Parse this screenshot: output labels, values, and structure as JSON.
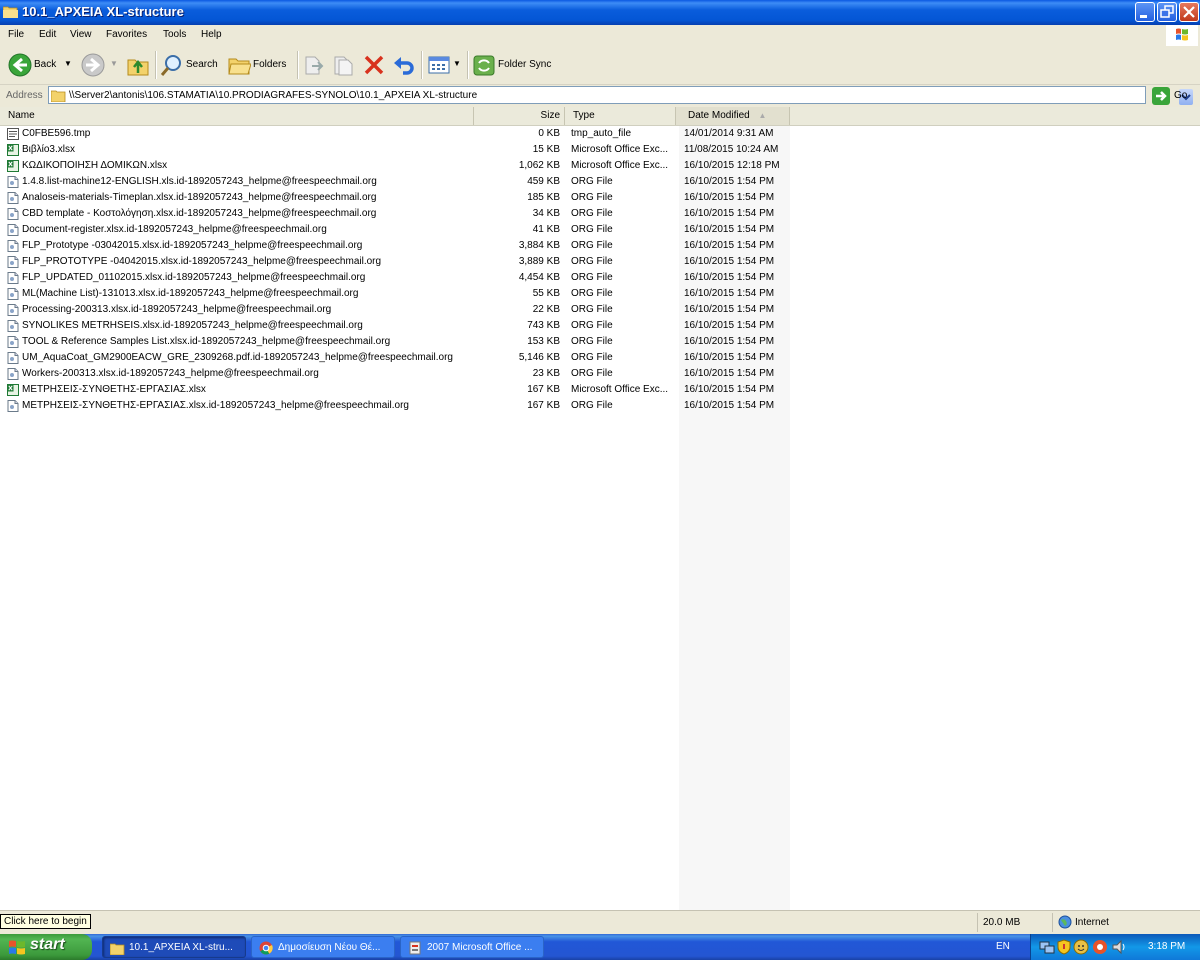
{
  "window": {
    "title": "10.1_ΑΡΧΕΙΑ XL-structure"
  },
  "menu": [
    "File",
    "Edit",
    "View",
    "Favorites",
    "Tools",
    "Help"
  ],
  "toolbar": {
    "back_label": "Back",
    "search_label": "Search",
    "folders_label": "Folders",
    "folder_sync_label": "Folder Sync"
  },
  "address": {
    "label": "Address",
    "path": "\\\\Server2\\antonis\\106.STAMATIA\\10.PRODIAGRAFES-SYNOLO\\10.1_ΑΡΧΕΙΑ XL-structure",
    "go_label": "Go"
  },
  "columns": {
    "name": "Name",
    "size": "Size",
    "type": "Type",
    "date": "Date Modified"
  },
  "files": [
    {
      "name": "C0FBE596.tmp",
      "size": "0 KB",
      "type": "tmp_auto_file",
      "date": "14/01/2014 9:31 AM",
      "icon": "tmp-file-icon"
    },
    {
      "name": "Βιβλίο3.xlsx",
      "size": "15 KB",
      "type": "Microsoft Office Exc...",
      "date": "11/08/2015 10:24 AM",
      "icon": "excel-file-icon"
    },
    {
      "name": "ΚΩΔΙΚΟΠΟΙΗΣΗ ΔΟΜΙΚΩΝ.xlsx",
      "size": "1,062 KB",
      "type": "Microsoft Office Exc...",
      "date": "16/10/2015 12:18 PM",
      "icon": "excel-file-icon"
    },
    {
      "name": "1.4.8.list-machine12-ENGLISH.xls.id-1892057243_helpme@freespeechmail.org",
      "size": "459 KB",
      "type": "ORG File",
      "date": "16/10/2015 1:54 PM",
      "icon": "generic-file-icon"
    },
    {
      "name": "Analoseis-materials-Timeplan.xlsx.id-1892057243_helpme@freespeechmail.org",
      "size": "185 KB",
      "type": "ORG File",
      "date": "16/10/2015 1:54 PM",
      "icon": "generic-file-icon"
    },
    {
      "name": "CBD template - Κοστολόγηση.xlsx.id-1892057243_helpme@freespeechmail.org",
      "size": "34 KB",
      "type": "ORG File",
      "date": "16/10/2015 1:54 PM",
      "icon": "generic-file-icon"
    },
    {
      "name": "Document-register.xlsx.id-1892057243_helpme@freespeechmail.org",
      "size": "41 KB",
      "type": "ORG File",
      "date": "16/10/2015 1:54 PM",
      "icon": "generic-file-icon"
    },
    {
      "name": "FLP_Prototype -03042015.xlsx.id-1892057243_helpme@freespeechmail.org",
      "size": "3,884 KB",
      "type": "ORG File",
      "date": "16/10/2015 1:54 PM",
      "icon": "generic-file-icon"
    },
    {
      "name": "FLP_PROTOTYPE -04042015.xlsx.id-1892057243_helpme@freespeechmail.org",
      "size": "3,889 KB",
      "type": "ORG File",
      "date": "16/10/2015 1:54 PM",
      "icon": "generic-file-icon"
    },
    {
      "name": "FLP_UPDATED_01102015.xlsx.id-1892057243_helpme@freespeechmail.org",
      "size": "4,454 KB",
      "type": "ORG File",
      "date": "16/10/2015 1:54 PM",
      "icon": "generic-file-icon"
    },
    {
      "name": "ML(Machine List)-131013.xlsx.id-1892057243_helpme@freespeechmail.org",
      "size": "55 KB",
      "type": "ORG File",
      "date": "16/10/2015 1:54 PM",
      "icon": "generic-file-icon"
    },
    {
      "name": "Processing-200313.xlsx.id-1892057243_helpme@freespeechmail.org",
      "size": "22 KB",
      "type": "ORG File",
      "date": "16/10/2015 1:54 PM",
      "icon": "generic-file-icon"
    },
    {
      "name": "SYNOLIKES METRHSEIS.xlsx.id-1892057243_helpme@freespeechmail.org",
      "size": "743 KB",
      "type": "ORG File",
      "date": "16/10/2015 1:54 PM",
      "icon": "generic-file-icon"
    },
    {
      "name": "TOOL & Reference Samples List.xlsx.id-1892057243_helpme@freespeechmail.org",
      "size": "153 KB",
      "type": "ORG File",
      "date": "16/10/2015 1:54 PM",
      "icon": "generic-file-icon"
    },
    {
      "name": "UM_AquaCoat_GM2900EACW_GRE_2309268.pdf.id-1892057243_helpme@freespeechmail.org",
      "size": "5,146 KB",
      "type": "ORG File",
      "date": "16/10/2015 1:54 PM",
      "icon": "generic-file-icon"
    },
    {
      "name": "Workers-200313.xlsx.id-1892057243_helpme@freespeechmail.org",
      "size": "23 KB",
      "type": "ORG File",
      "date": "16/10/2015 1:54 PM",
      "icon": "generic-file-icon"
    },
    {
      "name": "ΜΕΤΡΗΣΕΙΣ-ΣΥΝΘΕΤΗΣ-ΕΡΓΑΣΙΑΣ.xlsx",
      "size": "167 KB",
      "type": "Microsoft Office Exc...",
      "date": "16/10/2015 1:54 PM",
      "icon": "excel-file-icon"
    },
    {
      "name": "ΜΕΤΡΗΣΕΙΣ-ΣΥΝΘΕΤΗΣ-ΕΡΓΑΣΙΑΣ.xlsx.id-1892057243_helpme@freespeechmail.org",
      "size": "167 KB",
      "type": "ORG File",
      "date": "16/10/2015 1:54 PM",
      "icon": "generic-file-icon"
    }
  ],
  "status": {
    "tooltip": "Click here to begin",
    "size": "20.0 MB",
    "zone": "Internet"
  },
  "taskbar": {
    "start_label": "start",
    "tasks": [
      {
        "label": "10.1_ΑΡΧΕΙΑ XL-stru...",
        "active": true,
        "icon": "folder-icon"
      },
      {
        "label": "Δημοσίευση Νέου Θέ...",
        "active": false,
        "icon": "chrome-icon"
      },
      {
        "label": "2007 Microsoft Office ...",
        "active": false,
        "icon": "office-icon"
      }
    ],
    "language": "EN",
    "clock": "3:18 PM"
  },
  "colors": {
    "title_bar": "#0a5ddc",
    "taskbar": "#2456d2",
    "start_button": "#3c9a3c",
    "chrome": "#ece9d8"
  }
}
